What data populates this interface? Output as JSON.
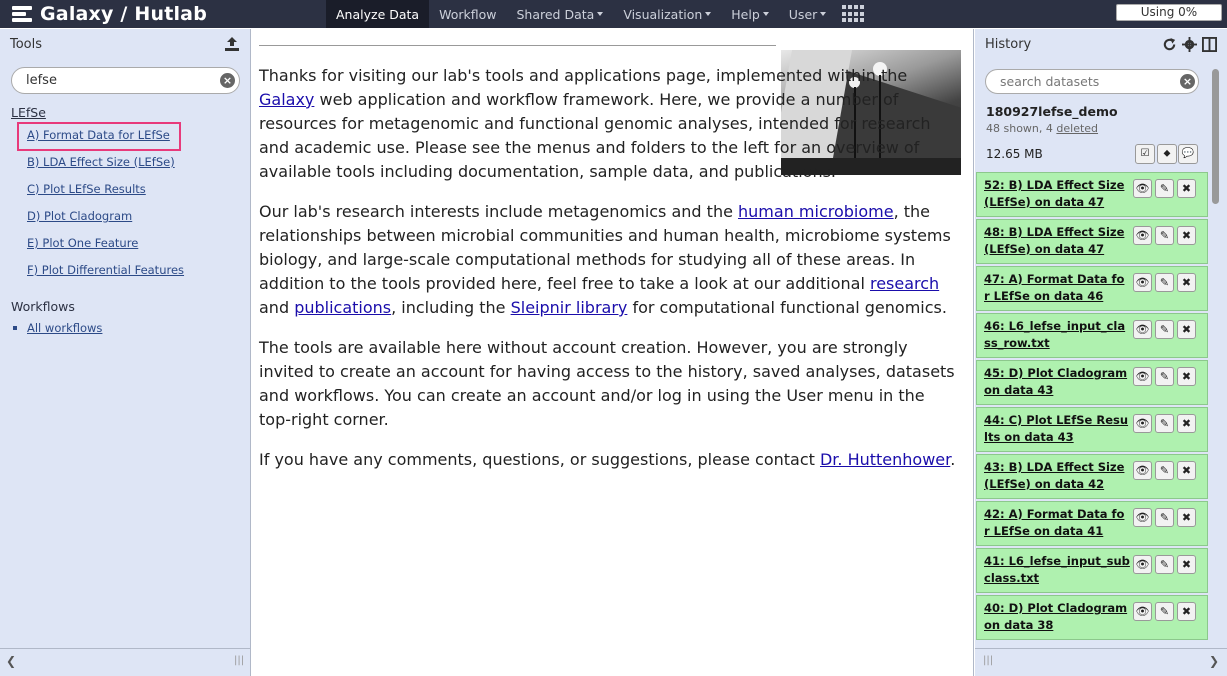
{
  "masthead": {
    "brand": "Galaxy / Hutlab",
    "nav": [
      {
        "label": "Analyze Data",
        "dropdown": false
      },
      {
        "label": "Workflow",
        "dropdown": false
      },
      {
        "label": "Shared Data",
        "dropdown": true
      },
      {
        "label": "Visualization",
        "dropdown": true
      },
      {
        "label": "Help",
        "dropdown": true
      },
      {
        "label": "User",
        "dropdown": true
      }
    ],
    "apps_icon": "grid-icon",
    "quota": "Using 0%",
    "colors": {
      "bg": "#2c3143",
      "active": "#1a1d29"
    }
  },
  "tools": {
    "title": "Tools",
    "upload_icon": "upload-icon",
    "search_value": "lefse",
    "section": "LEfSe",
    "items": [
      "A) Format Data for LEfSe",
      "B) LDA Effect Size (LEfSe)",
      "C) Plot LEfSe Results",
      "D) Plot Cladogram",
      "E) Plot One Feature",
      "F) Plot Differential Features"
    ],
    "workflows_title": "Workflows",
    "workflows_link": "All workflows",
    "highlight_color": "#e83a7b"
  },
  "center": {
    "p1_a": "Thanks for visiting our lab's tools and applications page, implemented within the ",
    "p1_link": "Galaxy",
    "p1_b": " web application and workflow framework. Here, we provide a number of resources for metagenomic and functional genomic analyses, intended for research and academic use. Please see the menus and folders to the left for an overview of available tools including documentation, sample data, and publications.",
    "p2_a": "Our lab's research interests include metagenomics and the ",
    "p2_link1": "human microbiome",
    "p2_b": ", the relationships between microbial communities and human health, microbiome systems biology, and large-scale computational methods for studying all of these areas. In addition to the tools provided here, feel free to take a look at our additional ",
    "p2_link2": "research",
    "p2_c": " and ",
    "p2_link3": "publications",
    "p2_d": ", including the ",
    "p2_link4": "Sleipnir library",
    "p2_e": " for computational functional genomics.",
    "p3": "The tools are available here without account creation. However, you are strongly invited to create an account for having access to the history, saved analyses, datasets and workflows. You can create an account and/or log in using the User menu in the top-right corner.",
    "p4_a": "If you have any comments, questions, or suggestions, please contact ",
    "p4_link": "Dr. Huttenhower",
    "p4_b": "."
  },
  "history": {
    "title": "History",
    "icons": [
      "refresh-icon",
      "gear-icon",
      "columns-icon"
    ],
    "search_placeholder": "search datasets",
    "name": "180927lefse_demo",
    "shown": "48 shown, 4 ",
    "deleted": "deleted",
    "size": "12.65 MB",
    "datasets": [
      "52: B) LDA Effect Size (LEfSe) on data 47",
      "48: B) LDA Effect Size (LEfSe) on data 47",
      "47: A) Format Data for LEfSe on data 46",
      "46: L6_lefse_input_class_row.txt",
      "45: D) Plot Cladogram on data 43",
      "44: C) Plot LEfSe Results on data 43",
      "43: B) LDA Effect Size (LEfSe) on data 42",
      "42: A) Format Data for LEfSe on data 41",
      "41: L6_lefse_input_subclass.txt",
      "40: D) Plot Cladogram on data 38"
    ],
    "dataset_color": "#aff1af"
  }
}
